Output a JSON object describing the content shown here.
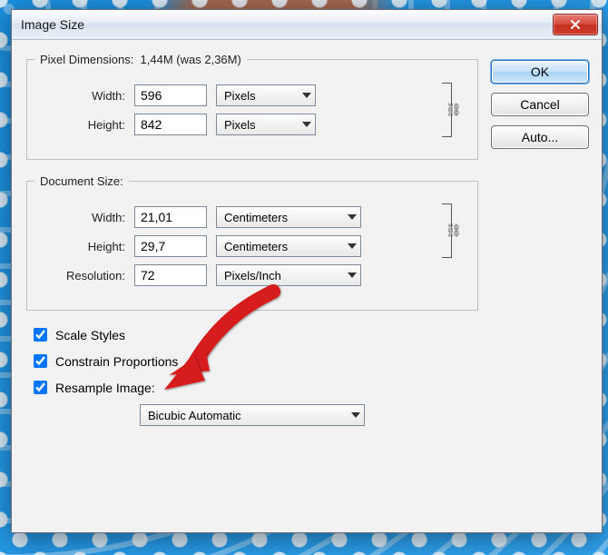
{
  "window": {
    "title": "Image Size"
  },
  "pixel_dimensions": {
    "legend_prefix": "Pixel Dimensions:  ",
    "summary": "1,44M (was 2,36M)",
    "width_label": "Width:",
    "width_value": "596",
    "width_unit": "Pixels",
    "height_label": "Height:",
    "height_value": "842",
    "height_unit": "Pixels"
  },
  "document_size": {
    "legend": "Document Size:",
    "width_label": "Width:",
    "width_value": "21,01",
    "width_unit": "Centimeters",
    "height_label": "Height:",
    "height_value": "29,7",
    "height_unit": "Centimeters",
    "resolution_label": "Resolution:",
    "resolution_value": "72",
    "resolution_unit": "Pixels/Inch"
  },
  "options": {
    "scale_styles": "Scale Styles",
    "constrain": "Constrain Proportions",
    "resample": "Resample Image:",
    "resample_method": "Bicubic Automatic"
  },
  "buttons": {
    "ok": "OK",
    "cancel": "Cancel",
    "auto": "Auto..."
  }
}
